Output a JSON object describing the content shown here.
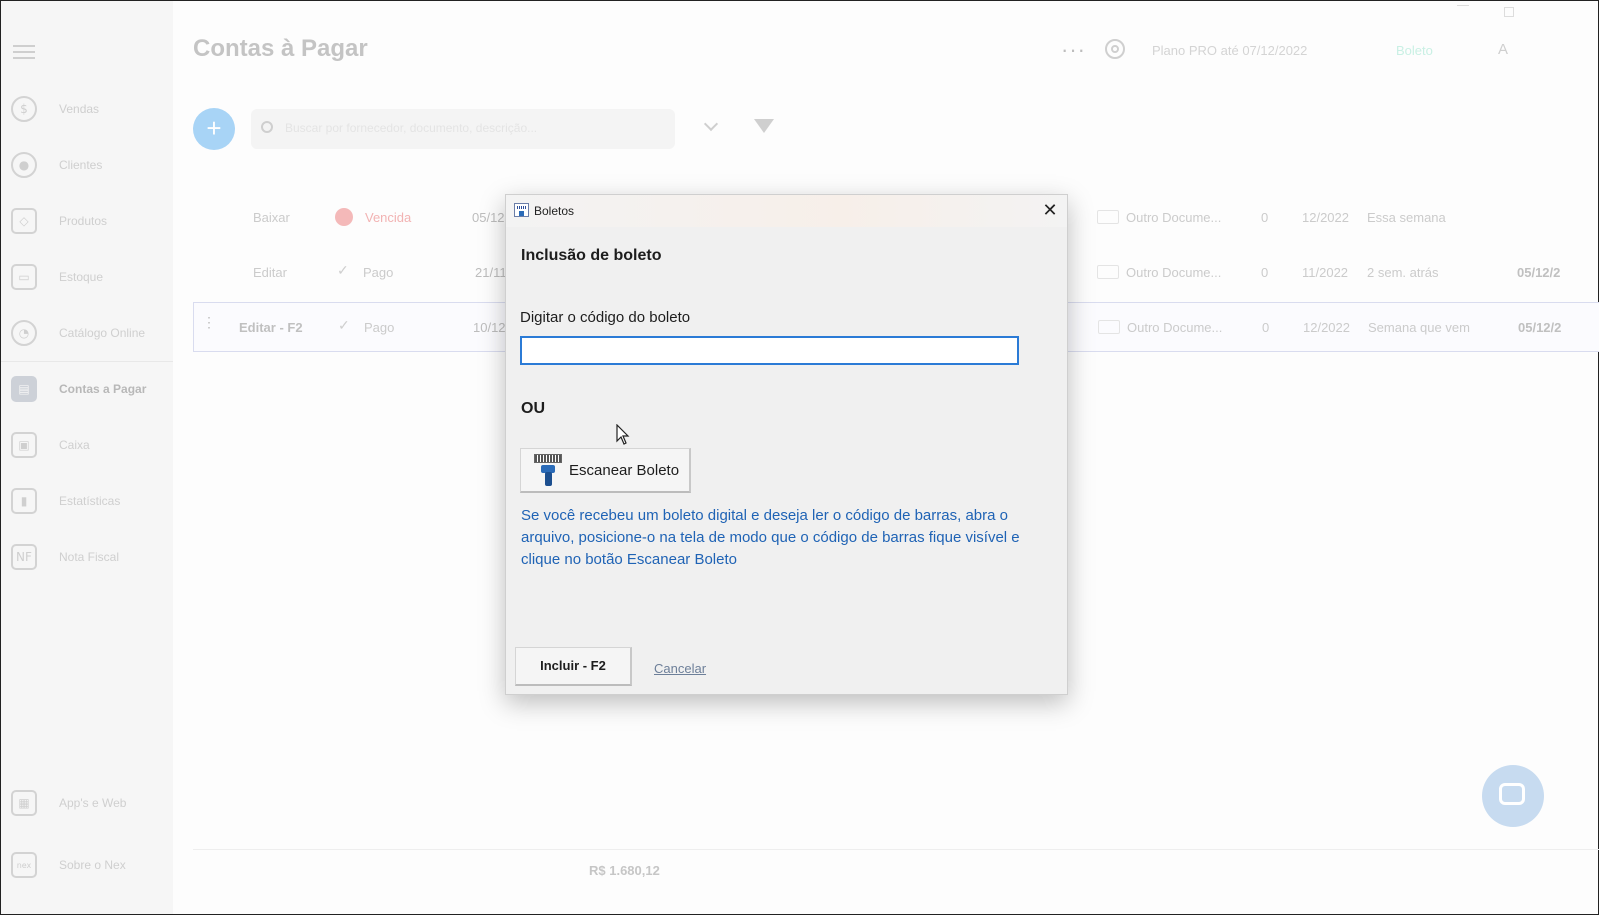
{
  "app": {
    "page_title": "Contas à Pagar",
    "top": {
      "more": "···",
      "plan": "Plano PRO até 07/12/2022",
      "boleto": "Boleto",
      "user_initial": "A"
    },
    "sidebar": {
      "items": [
        {
          "label": "Vendas",
          "icon": "$"
        },
        {
          "label": "Clientes",
          "icon": "●"
        },
        {
          "label": "Produtos",
          "icon": "◇"
        },
        {
          "label": "Estoque",
          "icon": "▭"
        },
        {
          "label": "Catálogo Online",
          "icon": "◔"
        },
        {
          "label": "Contas a Pagar",
          "icon": "▤"
        },
        {
          "label": "Caixa",
          "icon": "▣"
        },
        {
          "label": "Estatísticas",
          "icon": "▮"
        },
        {
          "label": "Nota Fiscal",
          "icon": "NF"
        }
      ],
      "bottom": [
        {
          "label": "App's e Web",
          "icon": "▦"
        },
        {
          "label": "Sobre o Nex",
          "icon": "nex"
        }
      ]
    },
    "search_placeholder": "Buscar por fornecedor, documento, descrição...",
    "rows": [
      {
        "action": "Baixar",
        "status": "Vencida",
        "due": "05/12",
        "type": "Outro Docume...",
        "count": "0",
        "month": "12/2022",
        "period": "Essa semana",
        "date": ""
      },
      {
        "action": "Editar",
        "status": "Pago",
        "due": "21/11",
        "type": "Outro Docume...",
        "count": "0",
        "month": "11/2022",
        "period": "2 sem. atrás",
        "date": "05/12/2"
      },
      {
        "action": "Editar - F2",
        "status": "Pago",
        "due": "10/12",
        "type": "Outro Docume...",
        "count": "0",
        "month": "12/2022",
        "period": "Semana que vem",
        "date": "05/12/2"
      }
    ],
    "footer_total": "R$ 1.680,12"
  },
  "dialog": {
    "title": "Boletos",
    "heading": "Inclusão de boleto",
    "field_label": "Digitar o código do boleto",
    "field_value": "",
    "or_label": "OU",
    "scan_button": "Escanear Boleto",
    "hint": "Se você recebeu um boleto digital e deseja ler o código de barras, abra o arquivo,  posicione-o na tela de modo que o código de barras fique visível e clique no botão Escanear Boleto",
    "include_button": "Incluir - F2",
    "cancel_link": "Cancelar"
  },
  "colors": {
    "accent_blue": "#2b7bd6",
    "hint_text": "#1f63b5",
    "add_button": "#a8d4f6"
  }
}
